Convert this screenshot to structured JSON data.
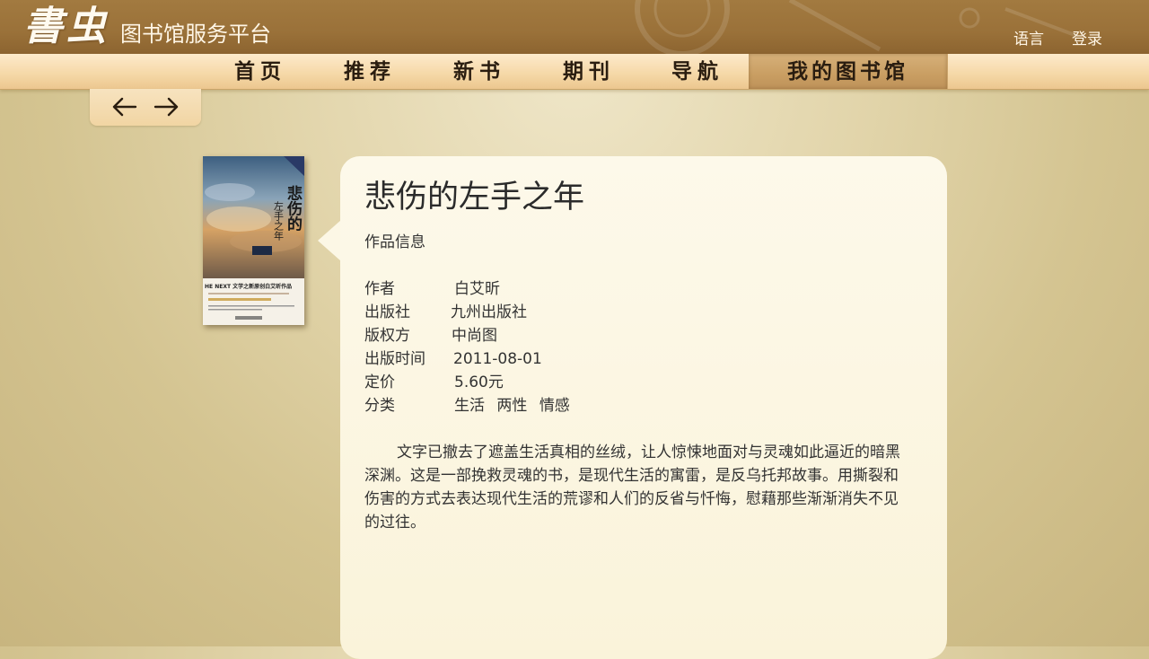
{
  "header": {
    "logo": "書虫",
    "platform_title": "图书馆服务平台",
    "language_label": "语言",
    "login_label": "登录"
  },
  "nav": {
    "items": [
      {
        "label": "首页"
      },
      {
        "label": "推荐"
      },
      {
        "label": "新书"
      },
      {
        "label": "期刊"
      },
      {
        "label": "导航"
      },
      {
        "label": "我的图书馆"
      }
    ],
    "active_index": 5
  },
  "toolbar": {
    "back_icon": "arrow-left-icon",
    "forward_icon": "arrow-right-icon"
  },
  "book": {
    "title": "悲伤的左手之年",
    "section_label": "作品信息",
    "cover": {
      "title_text": "悲伤的",
      "subtitle_text": "左手之年",
      "banner_text": "HE NEXT 文学之新原创白艾昕作品"
    },
    "info": [
      {
        "key": "作者",
        "value": "白艾昕"
      },
      {
        "key": "出版社",
        "value": "九州出版社"
      },
      {
        "key": "版权方",
        "value": "中尚图"
      },
      {
        "key": "出版时间",
        "value": "2011-08-01"
      },
      {
        "key": "定价",
        "value": "5.60元"
      }
    ],
    "category_label": "分类",
    "categories": [
      "生活",
      "两性",
      "情感"
    ],
    "description": "文字已撤去了遮盖生活真相的丝绒，让人惊悚地面对与灵魂如此逼近的暗黑深渊。这是一部挽救灵魂的书，是现代生活的寓雷，是反乌托邦故事。用撕裂和伤害的方式去表达现代生活的荒谬和人们的反省与忏悔，慰藉那些渐渐消失不见的过往。"
  },
  "colors": {
    "header_bg": "#9a7139",
    "nav_bg": "#f6d9a9",
    "nav_active": "#c99e62",
    "card_bg": "#fbf5df"
  }
}
